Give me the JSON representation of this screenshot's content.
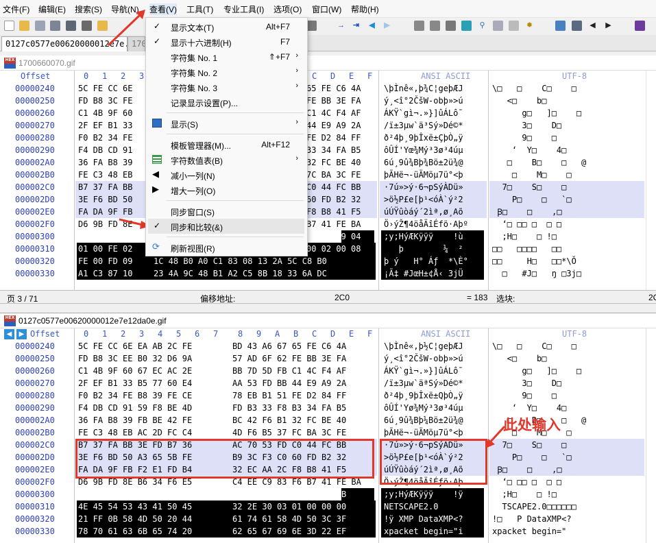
{
  "menubar": {
    "items": [
      "文件(F)",
      "编辑(E)",
      "搜索(S)",
      "导航(N)",
      "查看(V)",
      "工具(T)",
      "专业工具(I)",
      "选项(O)",
      "窗口(W)",
      "帮助(H)"
    ]
  },
  "tabs": [
    {
      "label": "0127c0577e00620000012e7e..."
    },
    {
      "label": "170"
    }
  ],
  "top_pane": {
    "filename": "1700660070.gif",
    "headers": {
      "offset": "Offset",
      "hex_digits": [
        "0",
        "1",
        "2",
        "3",
        "4",
        "5",
        "6",
        "7",
        "8",
        "9",
        "A",
        "B",
        "C",
        "D",
        "E",
        "F"
      ],
      "ascii": "ANSI ASCII",
      "utf8": "UTF-8"
    },
    "rows": [
      {
        "off": "00000240",
        "h1": "5C FE CC 6E",
        "h2": "65 FE C6 4A",
        "asc": "\\þÌnê«,þ¾C¦geþÆJ",
        "utf": "\\□   □    C□    □"
      },
      {
        "off": "00000250",
        "h1": "FD B8 3C FE",
        "h2": "FE BB 3E FA",
        "asc": "ý¸<î°2ČšW-obþ»>ú",
        "utf": "   <□    b□"
      },
      {
        "off": "00000260",
        "h1": "C1 4B 9F 60",
        "h2": "C1 4C F4 AF",
        "asc": "ÁKŸ`gì¬.»}]ûÁLô¯",
        "utf": "      g□   ]□    □"
      },
      {
        "off": "00000270",
        "h1": "2F EF B1 33",
        "h2": "44 E9 A9 2A",
        "asc": "/ï±3µw`ä³Sý»Dé©*",
        "utf": "      3□    D□"
      },
      {
        "off": "00000280",
        "h1": "F0 B2 34 FE",
        "h2": "FE D2 84 FF",
        "asc": "ð²4þ¸9þÎxë±ÇþÒ„ÿ",
        "utf": "      9□    □"
      },
      {
        "off": "00000290",
        "h1": "F4 DB CD 91",
        "h2": "33 34 FA B5",
        "asc": "ôÛÍ'Yœ¾Mý³3ø³4úµ",
        "utf": "    ʻ  Y□    4□"
      },
      {
        "off": "000002A0",
        "h1": "36 FA B8 39",
        "h2": "32 FC BE 40",
        "asc": "6ú¸9û¾Bþ¾Bö±2ü¾@",
        "utf": "   □    B□    □   @"
      },
      {
        "off": "000002B0",
        "h1": "FE C3 48 EB",
        "h2": "7C BA 3C FE",
        "asc": "þÃHë¬-üÄMöµ7ü°<þ",
        "utf": "    □    M□    □"
      },
      {
        "off": "000002C0",
        "h1": "B7 37 FA BB",
        "h2": "C0 44 FC BB",
        "asc": "·7ú»>ý·6¬pSýÀDü»",
        "utf": "  7□    S□    □",
        "sel": true
      },
      {
        "off": "000002D0",
        "h1": "3E F6 BD 50",
        "h2": "60 FD B2 32",
        "asc": ">ö½P£e[þ¹<óÀ`ý²2",
        "utf": "    P□    □   `□",
        "sel": true
      },
      {
        "off": "000002E0",
        "h1": "FA DA 9F FB",
        "h2": "F8 B8 41 F5",
        "asc": "úÚŸûòáý´2ìª,ø¸Aõ",
        "utf": " Ꞵ□    □    ,□",
        "sel": true
      },
      {
        "off": "000002F0",
        "h1": "D6 9B FD 8E",
        "h2": "B7 41 FE BA",
        "asc": "Ö›ýŽ¶4öåÄîÉfö·Aþº",
        "utf": "  ʻ□ □□ □  □ □"
      },
      {
        "off": "00000300",
        "h1": "3B 79 3B 48",
        "h2": "02 21 F9 04",
        "asc": ";y;HýÆKÿÿÿ    !ù",
        "utf": "  ;H□    □ !□"
      },
      {
        "off": "00000310",
        "h1": "01 00 FE 02",
        "h2": "00 02 00 08",
        "asc": "   þ        ¼  ²",
        "utf": "□□   □□□□   □□"
      },
      {
        "off": "00000320",
        "h1": "FE 00 FD 09",
        "h2": "1C 48 B0 A0 C1 83 08 13 2A 5C C8 B0",
        "asc": "þ ý   H° Áƒ  *\\È°",
        "utf": "□□     H□   □□*\\Ŏ"
      },
      {
        "off": "00000330",
        "h1": "A1 C3 87 10",
        "h2": "23 4A 9C 48 B1 A2 C5 8B 18 33 6A DC",
        "asc": "¡Ã‡ #JœH±¢Å‹ 3jÜ",
        "utf": "  □   #J□   ŋ □3j□"
      }
    ]
  },
  "status": {
    "page": "页 3 / 71",
    "offset_label": "偏移地址:",
    "offset_value": "2C0",
    "eq": "= 183",
    "select_label": "选块:",
    "tail": "2C"
  },
  "bottom_pane": {
    "filename": "0127c0577e00620000012e7e12da0e.gif",
    "headers": {
      "offset": "Offset",
      "hex_digits": [
        "0",
        "1",
        "2",
        "3",
        "4",
        "5",
        "6",
        "7",
        "8",
        "9",
        "A",
        "B",
        "C",
        "D",
        "E",
        "F"
      ],
      "ascii": "ANSI ASCII",
      "utf8": "UTF-8"
    },
    "rows": [
      {
        "off": "00000240",
        "h1": "5C FE CC 6E EA AB 2C FE",
        "h2": "BD 43 A6 67 65 FE C6 4A",
        "asc": "\\þÌnê«,þ½C¦geþÆJ",
        "utf": "\\□   □    C□    □"
      },
      {
        "off": "00000250",
        "h1": "FD B8 3C EE B0 32 D6 9A",
        "h2": "57 AD 6F 62 FE BB 3E FA",
        "asc": "ý¸<î°2ČšW-obþ»>ú",
        "utf": "   <□    b□"
      },
      {
        "off": "00000260",
        "h1": "C1 4B 9F 60 67 EC AC 2E",
        "h2": "BB 7D 5D FB C1 4C F4 AF",
        "asc": "ÁKŸ`gì¬.»}]ûÁLô¯",
        "utf": "      g□   ]□    □"
      },
      {
        "off": "00000270",
        "h1": "2F EF B1 33 B5 77 60 E4",
        "h2": "AA 53 FD BB 44 E9 A9 2A",
        "asc": "/ï±3µw`äªSý»Dé©*",
        "utf": "      3□    D□"
      },
      {
        "off": "00000280",
        "h1": "F0 B2 34 FE B8 39 FE CE",
        "h2": "78 EB B1 51 FE D2 84 FF",
        "asc": "ð²4þ¸9þÎxë±QþÒ„ÿ",
        "utf": "      9□    □"
      },
      {
        "off": "00000290",
        "h1": "F4 DB CD 91 59 F8 BE 4D",
        "h2": "FD B3 33 F8 B3 34 FA B5",
        "asc": "ôÛÍ'Yø¾Mý³3ø³4úµ",
        "utf": "    ʻ  Y□    4□"
      },
      {
        "off": "000002A0",
        "h1": "36 FA B8 39 FB BE 42 FE",
        "h2": "BC 42 F6 B1 32 FC BE 40",
        "asc": "6ú¸9û¾Bþ¼Bö±2ü¾@",
        "utf": "   □    B□    □   @"
      },
      {
        "off": "000002B0",
        "h1": "FE C3 48 EB AC 2D FC C4",
        "h2": "4D F6 B5 37 FC BA 3C FE",
        "asc": "þÃHë¬-üÄMöµ7ü°<þ",
        "utf": "    □    M□    □"
      },
      {
        "off": "000002C0",
        "h1": "B7 37 FA BB 3E FD B7 36",
        "h2": "AC 70 53 FD C0 44 FC BB",
        "asc": "·7ú»>ý·6¬pSýÀDü»",
        "utf": "  7□    S□    □",
        "sel": true
      },
      {
        "off": "000002D0",
        "h1": "3E F6 BD 50 A3 65 5B FE",
        "h2": "B9 3C F3 C0 60 FD B2 32",
        "asc": ">ö½P£e[þ¹<óÀ`ý²2",
        "utf": "    P□    □   `□",
        "sel": true
      },
      {
        "off": "000002E0",
        "h1": "FA DA 9F FB F2 E1 FD B4",
        "h2": "32 EC AA 2C F8 B8 41 F5",
        "asc": "úÚŸûòáý´2ìª,ø¸Aõ",
        "utf": " Ꞵ□    □    ,□",
        "sel": true
      },
      {
        "off": "000002F0",
        "h1": "D6 9B FD 8E B6 34 F6 E5",
        "h2": "C4 EE C9 83 F6 B7 41 FE BA",
        "asc": "Ö›ýŽ¶4öåÄîÉƒö·Aþ",
        "utf": "  ʻ□ □□ □  □ □"
      },
      {
        "off": "00000300",
        "h1": "3B 79 3B 48 FF C6 4B FF",
        "h2": "FF FF 00 00 00 21 FF 0B",
        "asc": ";y;HýÆKÿÿÿ    !ÿ",
        "utf": "  ;H□    □ !□"
      },
      {
        "off": "00000310",
        "h1": "4E 45 54 53 43 41 50 45",
        "h2": "32 2E 30 03 01 00 00 00",
        "asc": "NETSCAPE2.0",
        "utf": "  TSCAPE2.0□□□□□□"
      },
      {
        "off": "00000320",
        "h1": "21 FF 0B 58 4D 50 20 44",
        "h2": "61 74 61 58 4D 50 3C 3F",
        "asc": "!ÿ XMP DataXMP<?",
        "utf": "!□   P DataXMP<?"
      },
      {
        "off": "00000330",
        "h1": "78 70 61 63 6B 65 74 20",
        "h2": "62 65 67 69 6E 3D 22 EF",
        "asc": "xpacket begin=\"i",
        "utf": "xpacket begin=\""
      }
    ]
  },
  "view_menu": {
    "items": [
      {
        "label": "显示文本(T)",
        "shortcut": "Alt+F7",
        "checked": true
      },
      {
        "label": "显示十六进制(H)",
        "shortcut": "F7",
        "checked": true
      },
      {
        "label": "字符集 No. 1",
        "shortcut": "⇑+F7",
        "arrow": true
      },
      {
        "label": "字符集 No. 2",
        "arrow": true
      },
      {
        "label": "字符集 No. 3",
        "arrow": true
      },
      {
        "label": "记录显示设置(P)..."
      },
      {
        "label": "显示(S)",
        "arrow": true,
        "icon": "display-icon"
      },
      {
        "label": "模板管理器(M)...",
        "shortcut": "Alt+F12"
      },
      {
        "label": "字符数值表(B)",
        "arrow": true,
        "icon": "table-icon"
      },
      {
        "label": "减小一列(N)",
        "icon": "decrease-column-icon"
      },
      {
        "label": "增大一列(O)",
        "icon": "increase-column-icon"
      },
      {
        "label": "同步窗口(S)"
      },
      {
        "label": "同步和比较(&)",
        "checked": true,
        "highlighted": true
      },
      {
        "label": "刷新视图(R)",
        "icon": "refresh-icon"
      }
    ]
  },
  "annotation": {
    "text": "此处输入"
  },
  "colors": {
    "accent_red": "#e2372b",
    "offset_blue": "#2b3fb8",
    "selection": "#dde0f7",
    "header_blue": "#3a56c8"
  }
}
